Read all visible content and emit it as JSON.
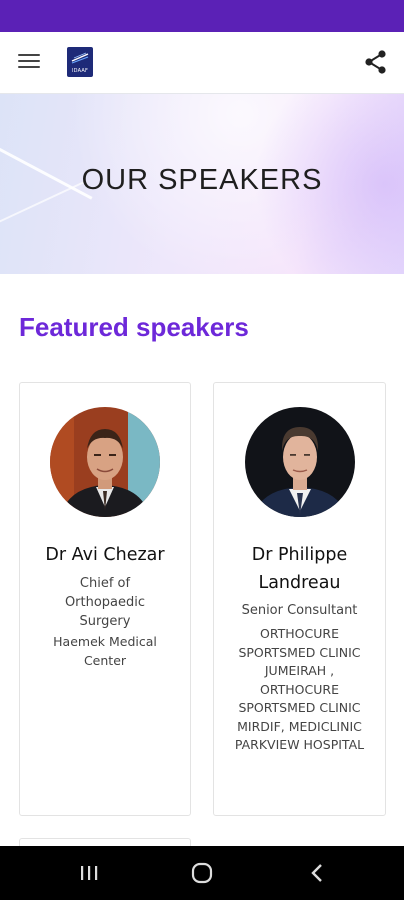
{
  "header": {
    "logo_text": "IDAAF",
    "menu_icon": "hamburger-menu-icon",
    "share_icon": "share-icon"
  },
  "hero": {
    "title": "OUR SPEAKERS"
  },
  "section": {
    "title": "Featured speakers"
  },
  "speakers": [
    {
      "name": "Dr Avi Chezar",
      "role": "Chief of Orthopaedic Surgery",
      "organization": "Haemek Medical Center"
    },
    {
      "name": "Dr Philippe Landreau",
      "role": "Senior Consultant",
      "organization": "ORTHOCURE SPORTSMED CLINIC JUMEIRAH , ORTHOCURE SPORTSMED CLINIC MIRDIF, MEDICLINIC PARKVIEW HOSPITAL"
    }
  ],
  "colors": {
    "status_bar": "#5b21b6",
    "accent": "#6d28d9",
    "nav_bar": "#000000"
  },
  "system_nav": {
    "recent_icon": "recent-apps-icon",
    "home_icon": "home-icon",
    "back_icon": "back-icon"
  }
}
